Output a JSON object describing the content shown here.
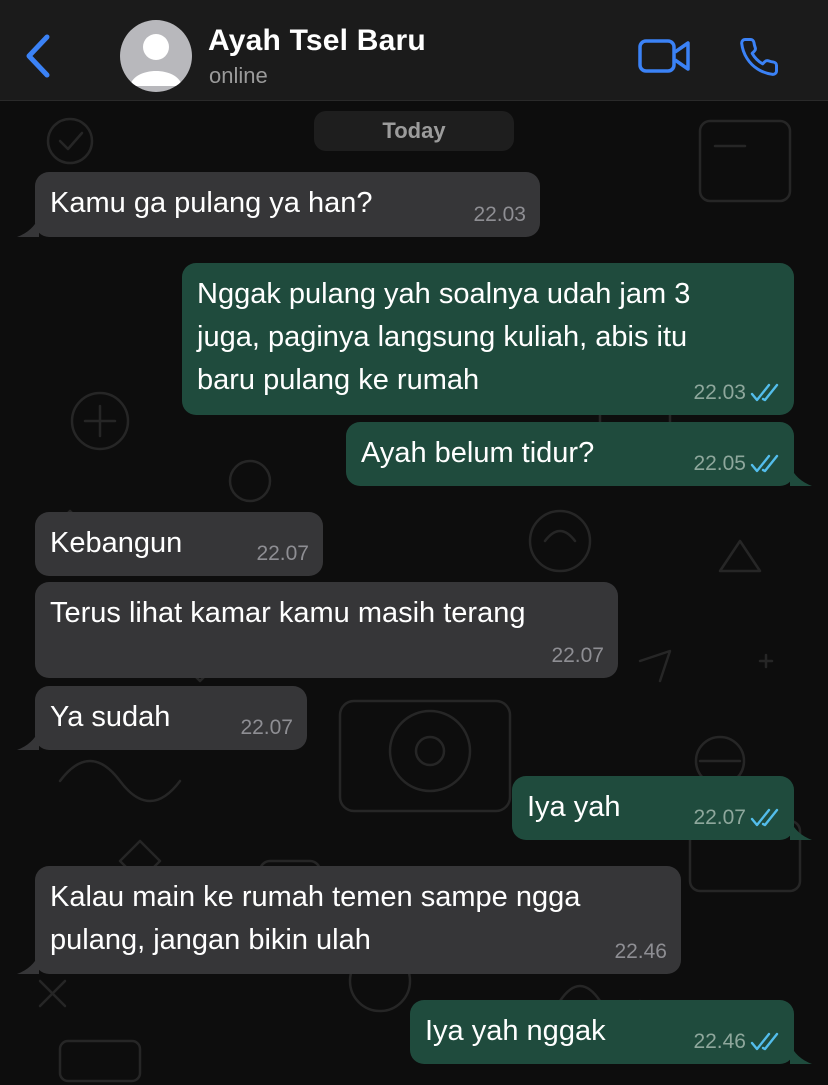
{
  "header": {
    "contact_name": "Ayah Tsel Baru",
    "status": "online",
    "accent_color": "#3b82f6",
    "icons": [
      "chevron-left-icon",
      "avatar-placeholder-icon",
      "video-camera-icon",
      "phone-icon"
    ]
  },
  "chat": {
    "date_label": "Today",
    "colors": {
      "incoming": "#363638",
      "outgoing": "#1f4b3d",
      "read_ticks": "#53bdeb"
    },
    "messages": [
      {
        "direction": "in",
        "text": "Kamu ga pulang ya han?",
        "time": "22.03"
      },
      {
        "direction": "out",
        "text": "Nggak pulang yah soalnya udah jam 3\njuga, paginya langsung kuliah, abis itu\nbaru pulang ke rumah",
        "time": "22.03",
        "status": "read"
      },
      {
        "direction": "out",
        "text": "Ayah belum tidur?",
        "time": "22.05",
        "status": "read"
      },
      {
        "direction": "in",
        "text": "Kebangun",
        "time": "22.07"
      },
      {
        "direction": "in",
        "text": "Terus lihat kamar kamu masih terang",
        "time": "22.07"
      },
      {
        "direction": "in",
        "text": "Ya sudah",
        "time": "22.07"
      },
      {
        "direction": "out",
        "text": "Iya yah",
        "time": "22.07",
        "status": "read"
      },
      {
        "direction": "in",
        "text": "Kalau main ke rumah temen sampe ngga\npulang, jangan bikin ulah",
        "time": "22.46"
      },
      {
        "direction": "out",
        "text": "Iya yah nggak",
        "time": "22.46",
        "status": "read"
      }
    ]
  }
}
